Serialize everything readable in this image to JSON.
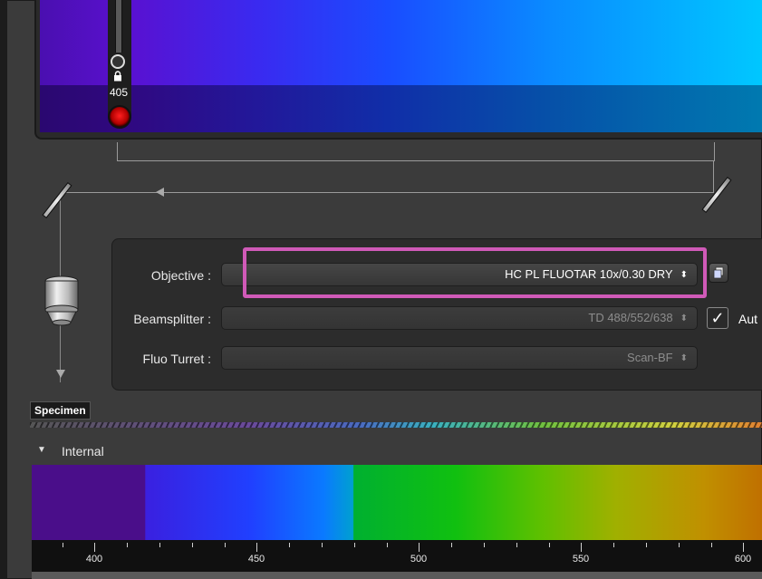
{
  "laser": {
    "wavelength_label": "405",
    "button_color": "#cc0000"
  },
  "settings": {
    "objective": {
      "label": "Objective :",
      "value": "HC PL FLUOTAR    10x/0.30 DRY",
      "arrows": "⬍"
    },
    "beamsplitter": {
      "label": "Beamsplitter :",
      "value": "TD 488/552/638",
      "arrows": "⬍",
      "auto_label": "Aut",
      "auto_checked": "✓"
    },
    "fluo_turret": {
      "label": "Fluo Turret :",
      "value": "Scan-BF",
      "arrows": "⬍"
    },
    "highlight_color": "#d05ab8"
  },
  "specimen_label": "Specimen",
  "internal": {
    "toggle": "▼",
    "label": "Internal"
  },
  "spectrum": {
    "tick_labels": [
      "400",
      "450",
      "500",
      "550",
      "600"
    ]
  },
  "icons": {
    "objective_settings": "copy-icon",
    "lock": "lock-icon"
  }
}
